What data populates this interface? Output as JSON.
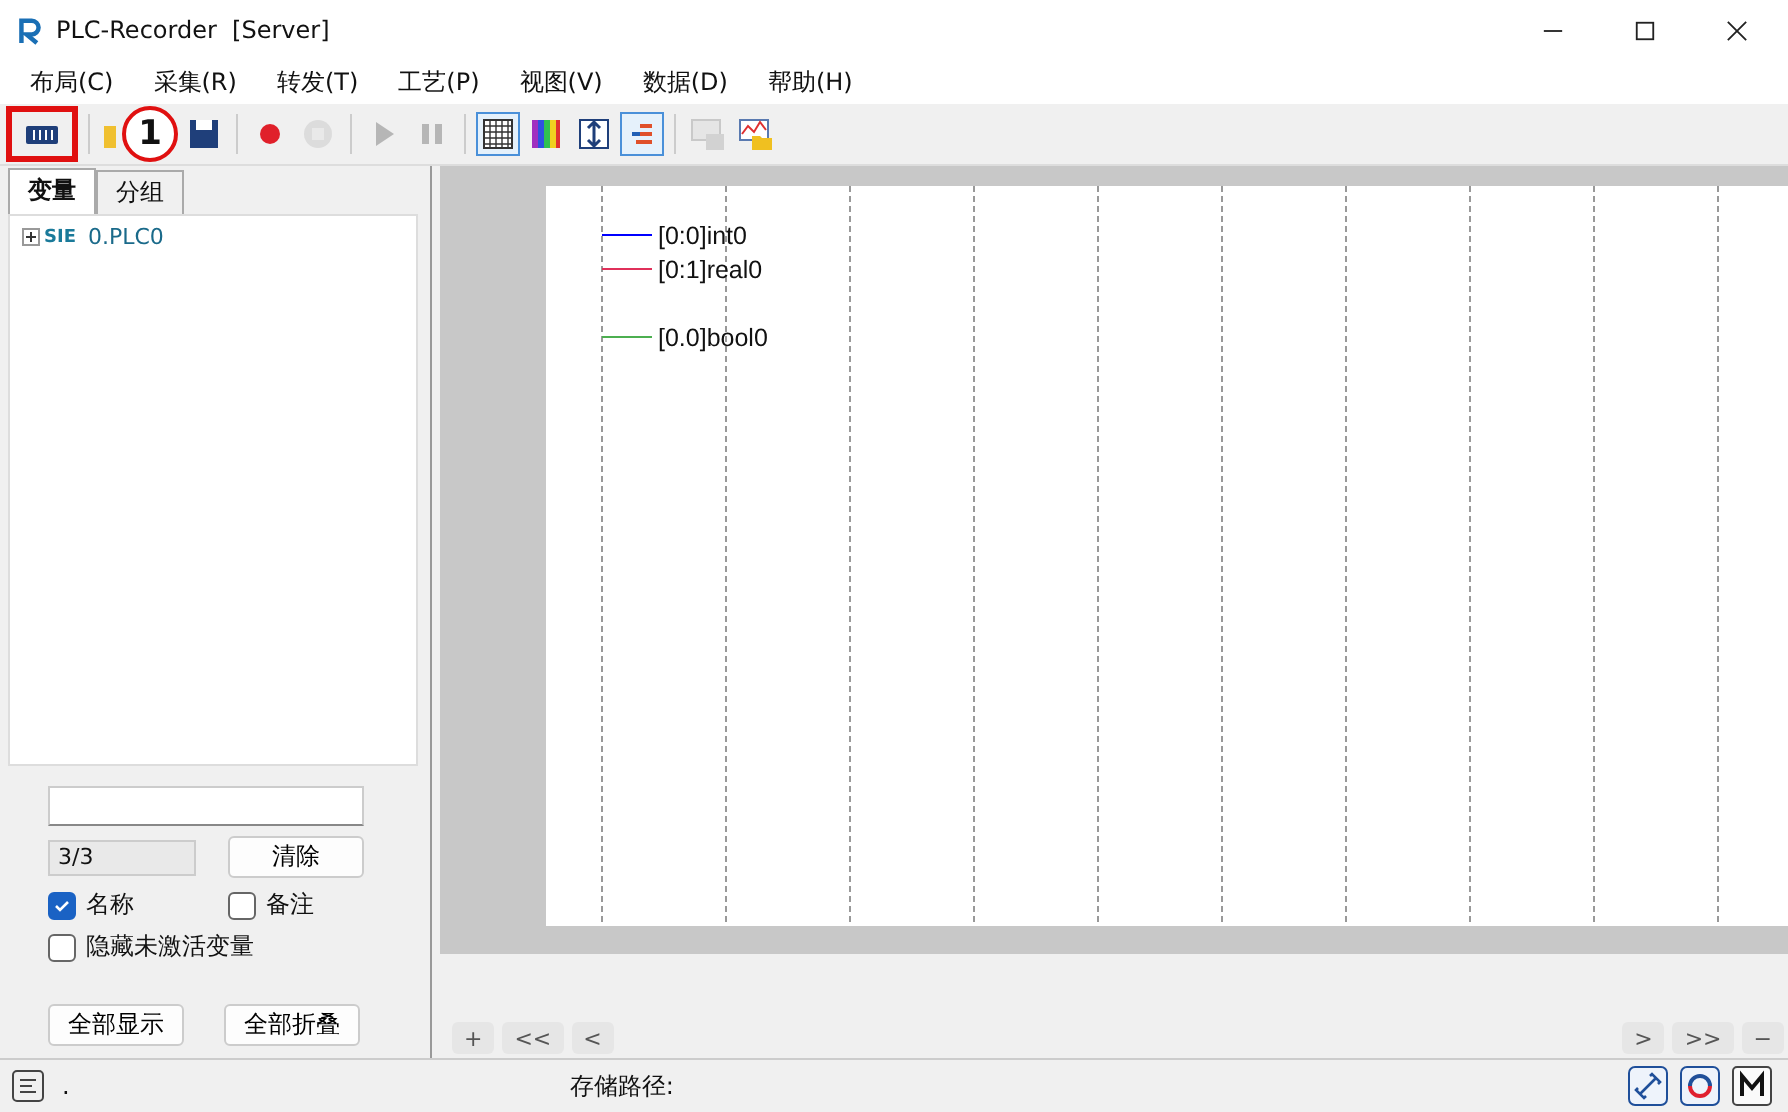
{
  "window": {
    "title": "PLC-Recorder  [Server]"
  },
  "menu": [
    "布局(C)",
    "采集(R)",
    "转发(T)",
    "工艺(P)",
    "视图(V)",
    "数据(D)",
    "帮助(H)"
  ],
  "toolbar": [
    {
      "selected": false,
      "disabled": false
    },
    {
      "selected": false,
      "disabled": false
    },
    {
      "selected": false,
      "disabled": false
    },
    {
      "selected": false,
      "disabled": false
    },
    {
      "selected": false,
      "disabled": true
    },
    {
      "selected": false,
      "disabled": true
    },
    {
      "selected": false,
      "disabled": true
    },
    {
      "selected": true,
      "disabled": false
    },
    {
      "selected": false,
      "disabled": false
    },
    {
      "selected": false,
      "disabled": false
    },
    {
      "selected": true,
      "disabled": false
    },
    {
      "selected": false,
      "disabled": true
    },
    {
      "selected": false,
      "disabled": false
    }
  ],
  "callout": {
    "label": "1"
  },
  "tabs": [
    {
      "label": "变量",
      "selected": true
    },
    {
      "label": "分组",
      "selected": false
    }
  ],
  "tree": [
    {
      "prefix": "SIE",
      "label": "0.PLC0",
      "expanded": false
    }
  ],
  "filter": {
    "count": "3/3",
    "clear_button": "清除"
  },
  "options": [
    {
      "label": "名称",
      "checked": true
    },
    {
      "label": "备注",
      "checked": false
    },
    {
      "label": "隐藏未激活变量",
      "checked": false
    }
  ],
  "panel_buttons": [
    "全部显示",
    "全部折叠"
  ],
  "legend": {
    "analog": [
      {
        "name": "[0:0]int0",
        "color": "#0000ff"
      },
      {
        "name": "[0:1]real0",
        "color": "#e0305a"
      }
    ],
    "digital": [
      {
        "name": "[0.0]bool0",
        "color": "#4caf50"
      }
    ]
  },
  "nav_left": [
    "+",
    "<<",
    "<"
  ],
  "nav_right": [
    ">",
    ">>",
    "−"
  ],
  "status": {
    "text": ".",
    "path_label": "存储路径:"
  }
}
